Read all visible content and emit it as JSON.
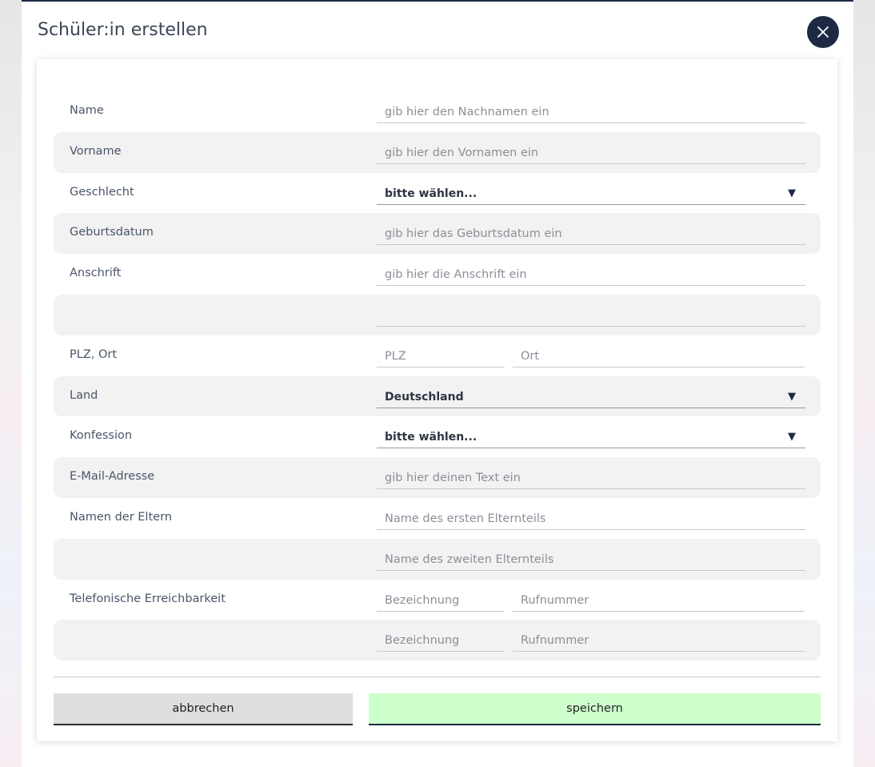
{
  "dialog": {
    "title": "Schüler:in erstellen"
  },
  "form": {
    "name": {
      "label": "Name",
      "placeholder": "gib hier den Nachnamen ein"
    },
    "vorname": {
      "label": "Vorname",
      "placeholder": "gib hier den Vornamen ein"
    },
    "geschlecht": {
      "label": "Geschlecht",
      "value": "bitte wählen..."
    },
    "geburtsdatum": {
      "label": "Geburtsdatum",
      "placeholder": "gib hier das Geburtsdatum ein"
    },
    "anschrift": {
      "label": "Anschrift",
      "placeholder": "gib hier die Anschrift ein",
      "line2_placeholder": ""
    },
    "plz_ort": {
      "label": "PLZ, Ort",
      "plz_placeholder": "PLZ",
      "ort_placeholder": "Ort"
    },
    "land": {
      "label": "Land",
      "value": "Deutschland"
    },
    "konfession": {
      "label": "Konfession",
      "value": "bitte wählen..."
    },
    "email": {
      "label": "E-Mail-Adresse",
      "placeholder": "gib hier deinen Text ein"
    },
    "eltern": {
      "label": "Namen der Eltern",
      "parent1_placeholder": "Name des ersten Elternteils",
      "parent2_placeholder": "Name des zweiten Elternteils"
    },
    "telefon": {
      "label": "Telefonische Erreichbarkeit",
      "entries": [
        {
          "bezeichnung_placeholder": "Bezeichnung",
          "rufnummer_placeholder": "Rufnummer"
        },
        {
          "bezeichnung_placeholder": "Bezeichnung",
          "rufnummer_placeholder": "Rufnummer"
        }
      ]
    }
  },
  "buttons": {
    "cancel": "abbrechen",
    "save": "speichern"
  },
  "icons": {
    "close": "close-icon",
    "dropdown": "triangle-down-icon"
  },
  "colors": {
    "primary": "#1e2a44",
    "save_bg": "#ccffcc",
    "cancel_bg": "#dedede"
  }
}
